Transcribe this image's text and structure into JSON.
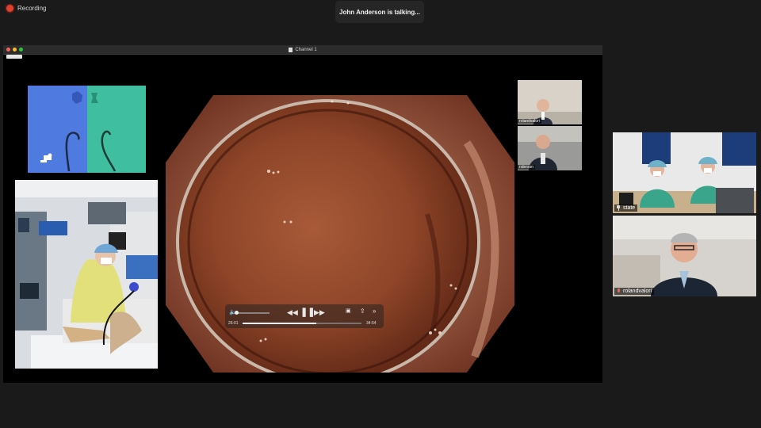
{
  "recording": {
    "label": "Recording"
  },
  "notification": {
    "text": "John Anderson is talking..."
  },
  "share_window": {
    "title": "Channel 1",
    "player": {
      "elapsed": "26:01",
      "remaining": "34:54",
      "progress": 0.62,
      "icons": [
        "volume-icon",
        "rewind-icon",
        "pause-icon",
        "forward-icon",
        "pip-icon",
        "share-icon",
        "speed-icon"
      ]
    },
    "mini_gallery": [
      {
        "name": "rolandvalori"
      },
      {
        "name": "nderson"
      }
    ]
  },
  "participants": [
    {
      "name": "state",
      "icon": "pin-icon"
    },
    {
      "name": "rolandvalori",
      "icon": "mic-muted-icon"
    }
  ],
  "colors": {
    "background": "#1a1a1a",
    "recording_dot": "#e0412c",
    "sim_left": "#4f7ae0",
    "sim_right": "#3fbf9f"
  }
}
